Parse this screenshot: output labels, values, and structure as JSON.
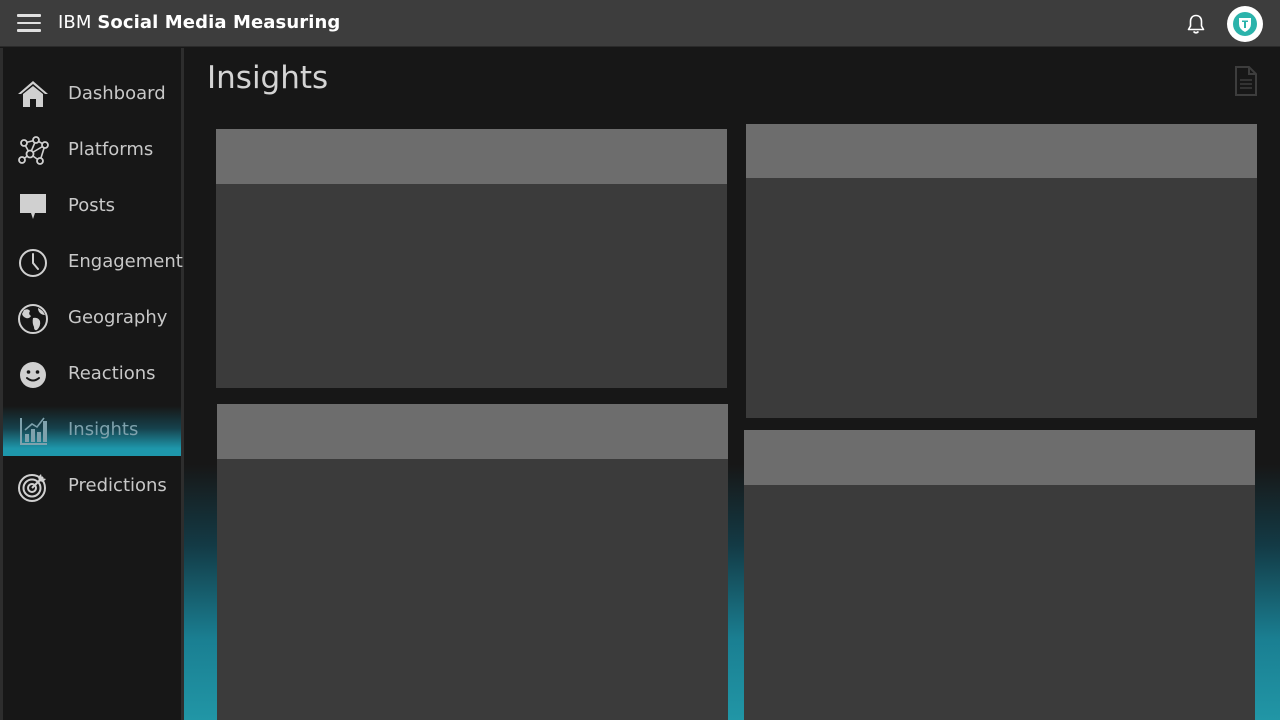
{
  "header": {
    "brand_prefix": "IBM",
    "brand_name": "Social Media Measuring",
    "menu_icon": "hamburger-menu-icon",
    "notification_icon": "bell-icon",
    "avatar_icon": "shield-avatar-icon"
  },
  "sidebar": {
    "items": [
      {
        "label": "Dashboard",
        "icon": "home-icon",
        "active": false
      },
      {
        "label": "Platforms",
        "icon": "network-icon",
        "active": false
      },
      {
        "label": "Posts",
        "icon": "chat-bubble-icon",
        "active": false
      },
      {
        "label": "Engagement",
        "icon": "clock-icon",
        "active": false
      },
      {
        "label": "Geography",
        "icon": "globe-icon",
        "active": false
      },
      {
        "label": "Reactions",
        "icon": "smiley-icon",
        "active": false
      },
      {
        "label": "Insights",
        "icon": "bar-chart-icon",
        "active": true
      },
      {
        "label": "Predictions",
        "icon": "target-icon",
        "active": false
      }
    ]
  },
  "main": {
    "page_title": "Insights",
    "export_icon": "document-icon"
  },
  "colors": {
    "header_bg": "#3d3d3d",
    "page_bg": "#171717",
    "accent": "#1e97ab",
    "card_bg": "#3b3b3b",
    "card_header_bg": "#6d6d6d"
  }
}
